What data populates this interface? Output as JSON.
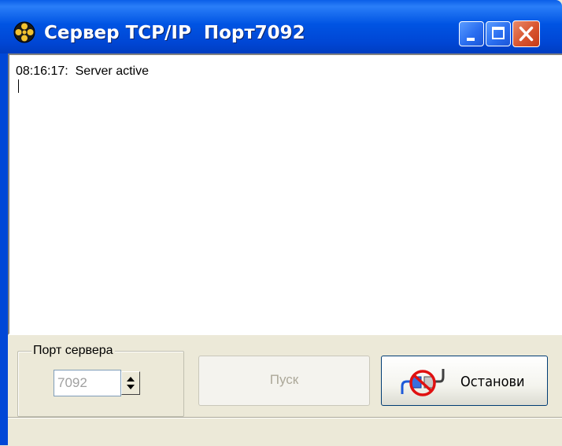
{
  "window": {
    "title": "Сервер TCP/IP  Порт7092",
    "icon": "network-globe-icon"
  },
  "title_buttons": {
    "minimize": "minimize-icon",
    "maximize": "maximize-icon",
    "close": "close-icon"
  },
  "log": {
    "lines": [
      "08:16:17:  Server active"
    ]
  },
  "port_group": {
    "label": "Порт сервера",
    "port_value": "7092"
  },
  "buttons": {
    "start_label": "Пуск",
    "stop_label": "Останови",
    "stop_icon": "disconnect-icon"
  },
  "colors": {
    "titlebar": "#0054e3",
    "close_button": "#d8542e",
    "disabled_text": "#aca899"
  }
}
